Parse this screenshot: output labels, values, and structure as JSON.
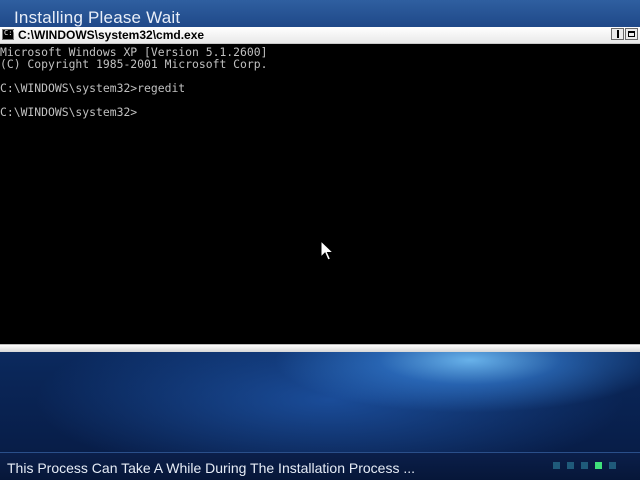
{
  "setup": {
    "title": "Installing   Please Wait",
    "status_text": "This Process Can Take A While During The Installation Process ...",
    "progress": {
      "total": 5,
      "active_index": 3
    },
    "colors": {
      "progress_active": "#3fe07a",
      "progress_inactive": "#1f5a7a"
    }
  },
  "cmd": {
    "icon": "cmd-icon",
    "icon_text": "C:\\",
    "title": "C:\\WINDOWS\\system32\\cmd.exe",
    "lines": [
      "Microsoft Windows XP [Version 5.1.2600]",
      "(C) Copyright 1985-2001 Microsoft Corp.",
      "",
      "C:\\WINDOWS\\system32>regedit",
      "",
      "C:\\WINDOWS\\system32>"
    ]
  },
  "cursor": {
    "icon": "mouse-pointer-icon"
  }
}
